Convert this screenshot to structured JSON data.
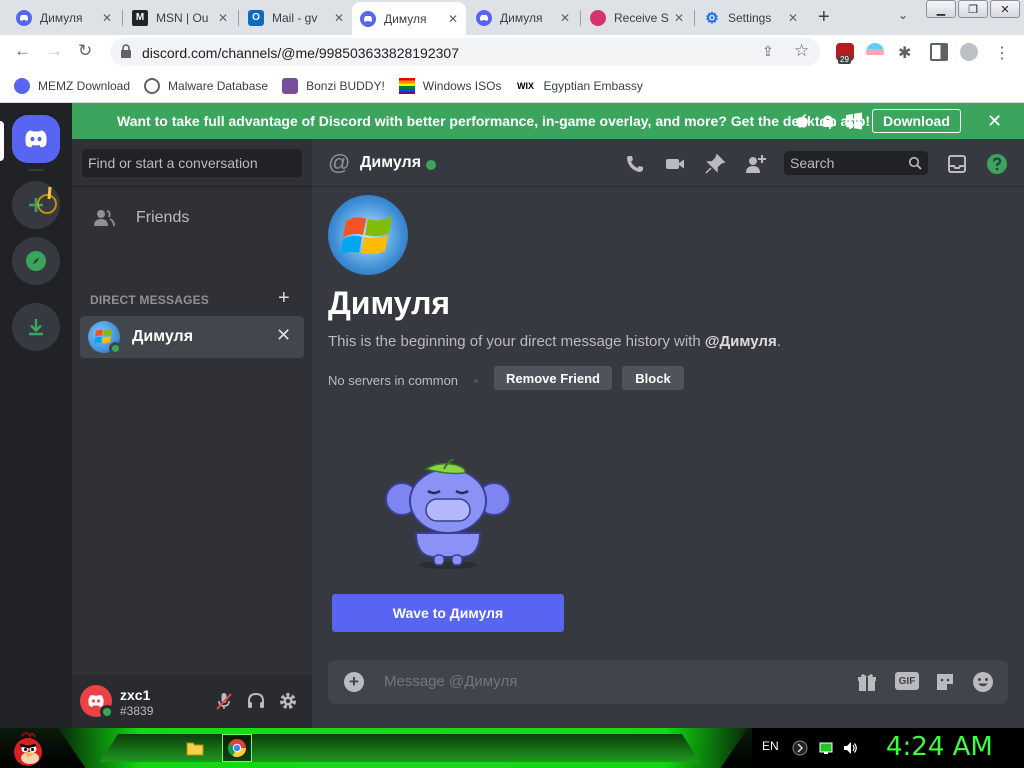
{
  "browser": {
    "tabs": [
      {
        "title": "Димуля",
        "favicon": "discord-icon",
        "color": "#5865f2"
      },
      {
        "title": "MSN | Ou",
        "favicon": "msn-icon",
        "color": "#222222"
      },
      {
        "title": "Mail - gv",
        "favicon": "outlook-icon",
        "color": "#0f6cbd"
      },
      {
        "title": "Димуля",
        "favicon": "discord-icon",
        "color": "#5865f2"
      },
      {
        "title": "Димуля",
        "favicon": "discord-icon",
        "color": "#5865f2"
      },
      {
        "title": "Receive S",
        "favicon": "receive-sms-icon",
        "color": "#d6336c"
      },
      {
        "title": "Settings",
        "favicon": "gear-icon",
        "color": "#1a73e8"
      }
    ],
    "active_tab_index": 3,
    "url": "discord.com/channels/@me/998503633828192307",
    "extension_badge": "29",
    "bookmarks": [
      {
        "label": "MEMZ Download",
        "icon": "discord-icon"
      },
      {
        "label": "Malware Database",
        "icon": "globe-icon"
      },
      {
        "label": "Bonzi BUDDY!",
        "icon": "bonzi-icon"
      },
      {
        "label": "Windows ISOs",
        "icon": "rainbow-flag-icon"
      },
      {
        "label": "Egyptian Embassy",
        "icon": "wix-icon"
      }
    ]
  },
  "discord": {
    "banner": {
      "message": "Want to take full advantage of Discord with better performance, in-game overlay, and more? Get the desktop app!",
      "download_label": "Download"
    },
    "dm_sidebar": {
      "search_placeholder": "Find or start a conversation",
      "friends_label": "Friends",
      "direct_messages_header": "DIRECT MESSAGES",
      "dms": [
        {
          "name": "Димуля",
          "status": "online"
        }
      ]
    },
    "user": {
      "name": "zxc1",
      "tag": "#3839",
      "status": "online"
    },
    "chat": {
      "recipient": "Димуля",
      "search_placeholder": "Search",
      "welcome_name": "Димуля",
      "welcome_text_prefix": "This is the beginning of your direct message history with ",
      "welcome_handle": "@Димуля",
      "welcome_text_suffix": ".",
      "no_servers": "No servers in common",
      "remove_friend_label": "Remove Friend",
      "block_label": "Block",
      "wave_label": "Wave to Димуля",
      "composer_placeholder": "Message @Димуля",
      "gif_label": "GIF"
    },
    "colors": {
      "blurple": "#5865f2",
      "green": "#3ba55d",
      "red": "#ed4245"
    }
  },
  "taskbar": {
    "language": "EN",
    "clock": "4:24 AM"
  }
}
